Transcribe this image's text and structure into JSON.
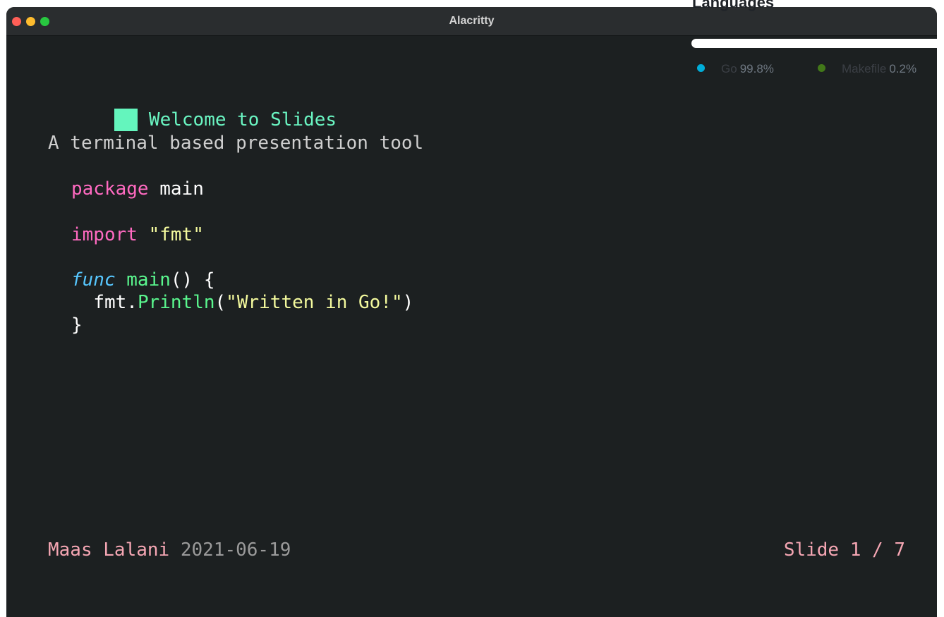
{
  "window": {
    "title": "Alacritty"
  },
  "slide": {
    "heading": "Welcome to Slides",
    "subtitle": "A terminal based presentation tool",
    "code": {
      "line1_kw": "package",
      "line1_rest": " main",
      "line2_kw": "import",
      "line2_str": "\"fmt\"",
      "line3_kw": "func",
      "line3_fn": "main",
      "line3_rest": "() {",
      "line4_obj": "fmt.",
      "line4_fn": "Println",
      "line4_open": "(",
      "line4_str": "\"Written in Go!\"",
      "line4_close": ")",
      "line5": "}"
    },
    "footer": {
      "author": "Maas Lalani",
      "date": "2021-06-19",
      "slide_counter": "Slide 1 / 7"
    }
  },
  "languages": {
    "title": "Languages",
    "items": [
      {
        "name": "Go",
        "percent": "99.8%",
        "color": "#00ADD8"
      },
      {
        "name": "Makefile",
        "percent": "0.2%",
        "color": "#427819"
      }
    ]
  },
  "colors": {
    "terminal_bg": "#1c2021",
    "heading": "#6af5c2",
    "keyword": "#ff6ac1",
    "string": "#f3f99d",
    "function": "#5af78e",
    "func_keyword": "#57c7ff",
    "author": "#f5a6b3"
  }
}
